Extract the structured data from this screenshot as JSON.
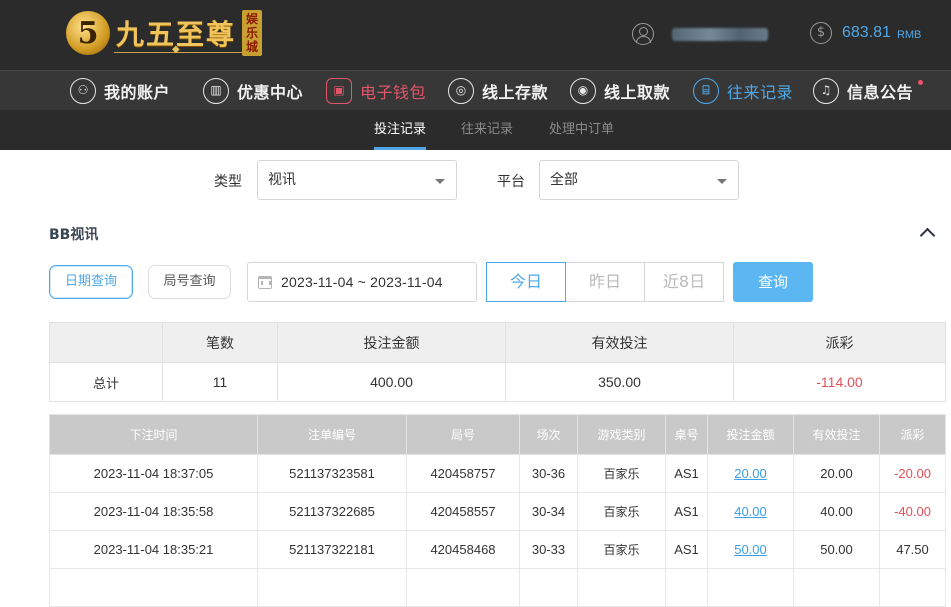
{
  "header": {
    "logo_glyph": "5",
    "logo_text": "九五至尊",
    "logo_seal": "娱乐城",
    "balance": "683.81",
    "currency": "RMB"
  },
  "nav": {
    "items": [
      {
        "label": "我的账户",
        "icon": "user-icon"
      },
      {
        "label": "优惠中心",
        "icon": "gift-icon"
      },
      {
        "label": "电子钱包",
        "icon": "wallet-icon"
      },
      {
        "label": "线上存款",
        "icon": "deposit-icon"
      },
      {
        "label": "线上取款",
        "icon": "withdraw-icon"
      },
      {
        "label": "往来记录",
        "icon": "record-icon"
      },
      {
        "label": "信息公告",
        "icon": "bell-icon"
      }
    ]
  },
  "subtabs": [
    "投注记录",
    "往来记录",
    "处理中订单"
  ],
  "filters": {
    "type_label": "类型",
    "type_value": "视讯",
    "platform_label": "平台",
    "platform_value": "全部"
  },
  "section": {
    "title": "BB视讯",
    "mode_date": "日期查询",
    "mode_round": "局号查询",
    "date_range": "2023-11-04 ~ 2023-11-04",
    "quick_today": "今日",
    "quick_yesterday": "昨日",
    "quick_8days": "近8日",
    "query_button": "查询"
  },
  "summary": {
    "headers": [
      "",
      "笔数",
      "投注金额",
      "有效投注",
      "派彩"
    ],
    "row": {
      "label": "总计",
      "count": "11",
      "bet": "400.00",
      "valid": "350.00",
      "payout": "-114.00"
    }
  },
  "detail": {
    "headers": [
      "下注时间",
      "注单编号",
      "局号",
      "场次",
      "游戏类别",
      "桌号",
      "投注金额",
      "有效投注",
      "派彩"
    ],
    "rows": [
      {
        "time": "2023-11-04 18:37:05",
        "order": "521137323581",
        "round": "420458757",
        "session": "30-36",
        "game": "百家乐",
        "table": "AS1",
        "bet": "20.00",
        "valid": "20.00",
        "payout": "-20.00"
      },
      {
        "time": "2023-11-04 18:35:58",
        "order": "521137322685",
        "round": "420458557",
        "session": "30-34",
        "game": "百家乐",
        "table": "AS1",
        "bet": "40.00",
        "valid": "40.00",
        "payout": "-40.00"
      },
      {
        "time": "2023-11-04 18:35:21",
        "order": "521137322181",
        "round": "420458468",
        "session": "30-33",
        "game": "百家乐",
        "table": "AS1",
        "bet": "50.00",
        "valid": "50.00",
        "payout": "47.50"
      }
    ]
  }
}
